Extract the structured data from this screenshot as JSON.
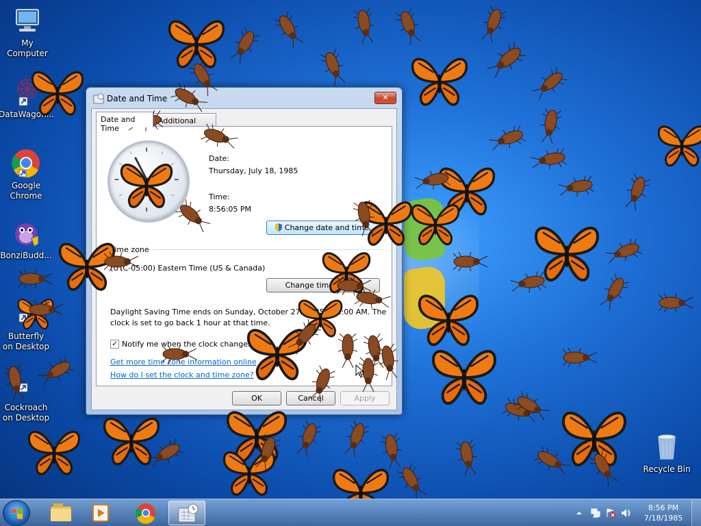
{
  "desktop": {
    "icons": [
      {
        "label": "My Computer"
      },
      {
        "label": "DataWagon..."
      },
      {
        "label": "Google Chrome"
      },
      {
        "label": "BonziBudd..."
      },
      {
        "label": "Butterfly on Desktop"
      },
      {
        "label": "Cockroach on Desktop"
      },
      {
        "label": "Recycle Bin"
      }
    ]
  },
  "window": {
    "title": "Date and Time",
    "close_label": "✕",
    "tabs": [
      {
        "label": "Date and Time"
      },
      {
        "label": "Additional Clocks"
      }
    ],
    "date_label": "Date:",
    "date_value": "Thursday, July 18, 1985",
    "time_label": "Time:",
    "time_value": "8:56:05 PM",
    "change_datetime_button": "Change date and time...",
    "timezone_group": "Time zone",
    "timezone_value": "(UTC-05:00) Eastern Time (US & Canada)",
    "change_timezone_button": "Change time zone...",
    "dst_line1": "Daylight Saving Time ends on Sunday, October 27, 1985 at 2:00 AM. The",
    "dst_line2": "clock is set to go back 1 hour at that time.",
    "notify_label": "Notify me when the clock changes",
    "notify_checked": true,
    "link1": "Get more time zone information online",
    "link2": "How do I set the clock and time zone?",
    "ok_label": "OK",
    "cancel_label": "Cancel",
    "apply_label": "Apply"
  },
  "taskbar": {
    "pinned": [
      "windows-explorer",
      "media-player",
      "google-chrome",
      "date-and-time"
    ],
    "time": "8:56 PM",
    "date": "7/18/1985"
  }
}
